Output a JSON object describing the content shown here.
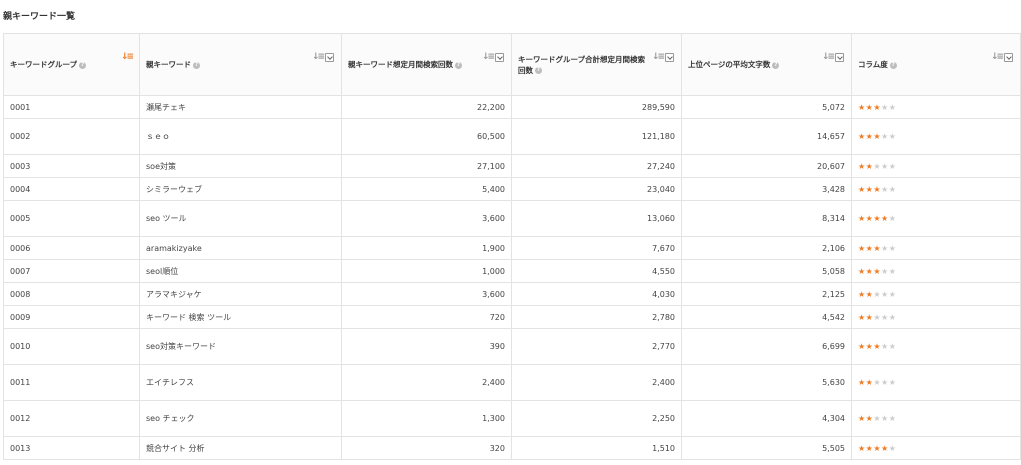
{
  "page": {
    "title": "親キーワード一覧"
  },
  "colors": {
    "accent": "#f07b22",
    "star_off": "#cccccc",
    "header_bg": "#fbfbfb",
    "border": "#e3e3e3"
  },
  "table": {
    "headers": [
      {
        "label": "キーワードグループ",
        "sortable": true,
        "active_sort": true,
        "filter": false
      },
      {
        "label": "親キーワード",
        "sortable": true,
        "active_sort": false,
        "filter": true
      },
      {
        "label": "親キーワード想定月間検索回数",
        "sortable": true,
        "active_sort": false,
        "filter": true
      },
      {
        "label": "キーワードグループ合計想定月間検索回数",
        "sortable": true,
        "active_sort": false,
        "filter": true
      },
      {
        "label": "上位ページの平均文字数",
        "sortable": true,
        "active_sort": false,
        "filter": true
      },
      {
        "label": "コラム度",
        "sortable": true,
        "active_sort": false,
        "filter": true
      }
    ],
    "max_stars": 5,
    "rows": [
      {
        "group": "0001",
        "keyword": "瀬尾チェキ",
        "volume": "22,200",
        "group_volume": "289,590",
        "avg_chars": "5,072",
        "column_score": 3
      },
      {
        "group": "0002",
        "keyword": "ｓｅｏ",
        "volume": "60,500",
        "group_volume": "121,180",
        "avg_chars": "14,657",
        "column_score": 3
      },
      {
        "group": "0003",
        "keyword": "soe対策",
        "volume": "27,100",
        "group_volume": "27,240",
        "avg_chars": "20,607",
        "column_score": 2
      },
      {
        "group": "0004",
        "keyword": "シミラーウェブ",
        "volume": "5,400",
        "group_volume": "23,040",
        "avg_chars": "3,428",
        "column_score": 3
      },
      {
        "group": "0005",
        "keyword": "seo ツール",
        "volume": "3,600",
        "group_volume": "13,060",
        "avg_chars": "8,314",
        "column_score": 4
      },
      {
        "group": "0006",
        "keyword": "aramakizyake",
        "volume": "1,900",
        "group_volume": "7,670",
        "avg_chars": "2,106",
        "column_score": 3
      },
      {
        "group": "0007",
        "keyword": "seol順位",
        "volume": "1,000",
        "group_volume": "4,550",
        "avg_chars": "5,058",
        "column_score": 3
      },
      {
        "group": "0008",
        "keyword": "アラマキジャケ",
        "volume": "3,600",
        "group_volume": "4,030",
        "avg_chars": "2,125",
        "column_score": 2
      },
      {
        "group": "0009",
        "keyword": "キーワード 検索 ツール",
        "volume": "720",
        "group_volume": "2,780",
        "avg_chars": "4,542",
        "column_score": 2
      },
      {
        "group": "0010",
        "keyword": "seo対策キーワード",
        "volume": "390",
        "group_volume": "2,770",
        "avg_chars": "6,699",
        "column_score": 3
      },
      {
        "group": "0011",
        "keyword": "エイチレフス",
        "volume": "2,400",
        "group_volume": "2,400",
        "avg_chars": "5,630",
        "column_score": 2
      },
      {
        "group": "0012",
        "keyword": "seo チェック",
        "volume": "1,300",
        "group_volume": "2,250",
        "avg_chars": "4,304",
        "column_score": 2
      },
      {
        "group": "0013",
        "keyword": "競合サイト 分析",
        "volume": "320",
        "group_volume": "1,510",
        "avg_chars": "5,505",
        "column_score": 4
      }
    ]
  }
}
